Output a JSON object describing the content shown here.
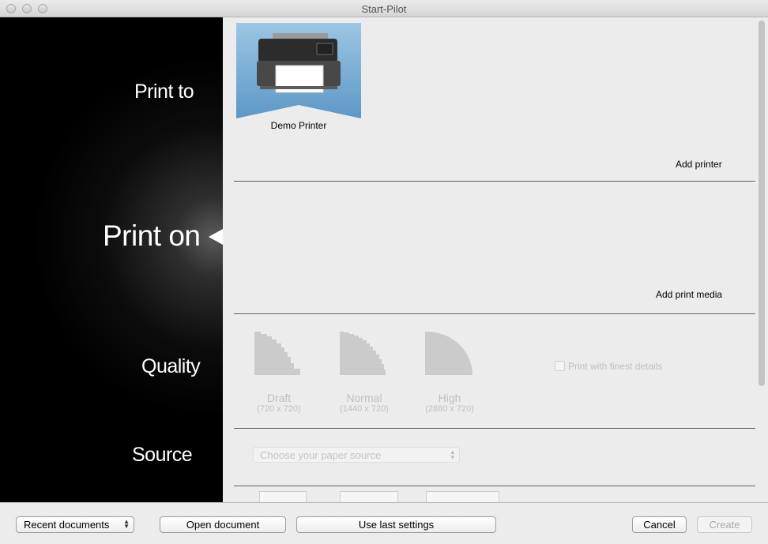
{
  "window": {
    "title": "Start-Pilot"
  },
  "sidebar": {
    "print_to": "Print to",
    "print_on": "Print on",
    "quality": "Quality",
    "source": "Source"
  },
  "printer": {
    "name": "Demo Printer",
    "add_printer": "Add printer"
  },
  "media": {
    "add_print_media": "Add print media"
  },
  "quality": {
    "options": [
      {
        "name": "Draft",
        "resolution": "(720 x 720)"
      },
      {
        "name": "Normal",
        "resolution": "(1440 x 720)"
      },
      {
        "name": "High",
        "resolution": "(2880 x 720)"
      }
    ],
    "finest_details": "Print with finest details"
  },
  "source": {
    "placeholder": "Choose your paper source"
  },
  "footer": {
    "recent_documents": "Recent documents",
    "open_document": "Open document",
    "use_last_settings": "Use last settings",
    "cancel": "Cancel",
    "create": "Create"
  },
  "colors": {
    "sidebar_bg": "#000000",
    "content_bg": "#ececec",
    "tile_blue": "#6fa6cf"
  }
}
